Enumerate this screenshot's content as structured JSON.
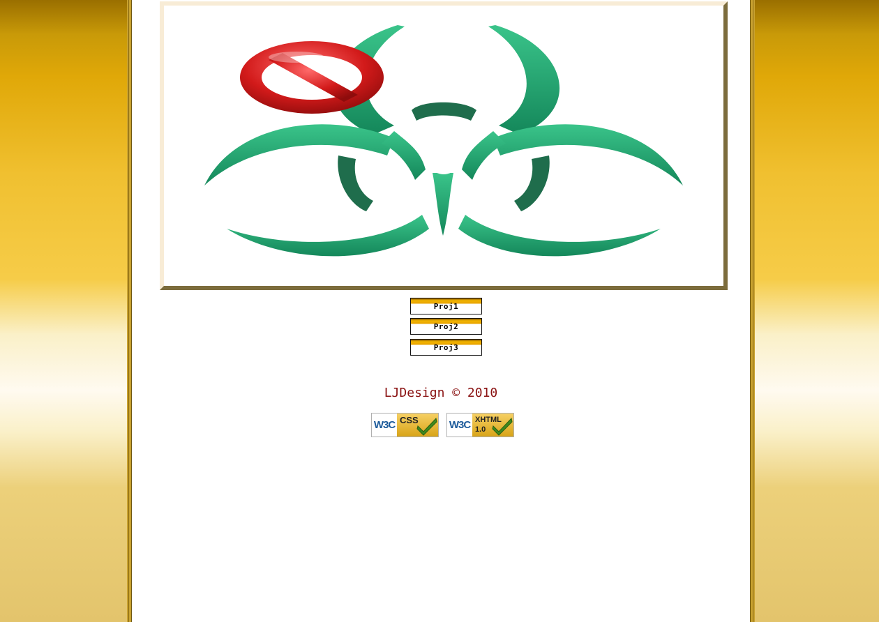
{
  "banner": {
    "image": "biohazard-symbol-with-prohibition-sign"
  },
  "nav": {
    "items": [
      {
        "label": "Proj1"
      },
      {
        "label": "Proj2"
      },
      {
        "label": "Proj3"
      }
    ]
  },
  "footer": {
    "copyright": "LJDesign © 2010",
    "badges": {
      "css": {
        "w3c": "W3C",
        "label": "CSS"
      },
      "xhtml": {
        "w3c": "W3C",
        "label": "XHTML",
        "version": "1.0"
      }
    }
  },
  "colors": {
    "page_gold": "#f0c030",
    "biohazard_green": "#1fa36a",
    "prohibit_red": "#c81818",
    "copyright_text": "#8a1212",
    "banner_frame_dark": "#7c6c3c"
  }
}
